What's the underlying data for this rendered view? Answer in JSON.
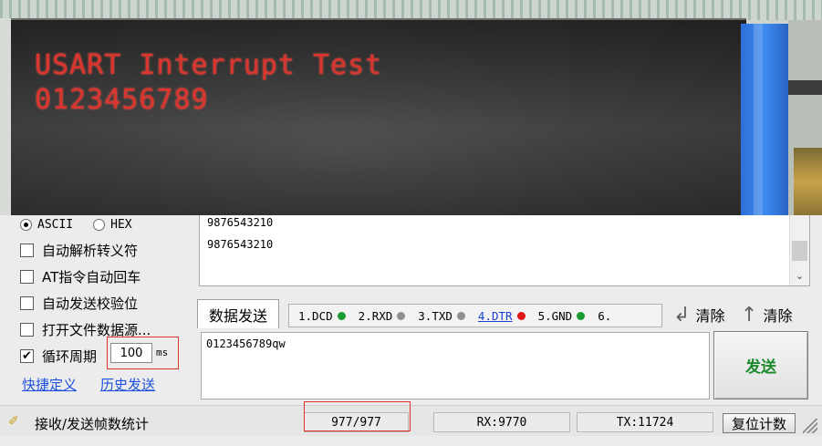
{
  "lcd": {
    "line1": "USART Interrupt Test",
    "line2": "0123456789"
  },
  "options": {
    "format_ascii": "ASCII",
    "format_hex": "HEX",
    "format_selected": "ASCII",
    "auto_escape": "自动解析转义符",
    "at_auto_newline": "AT指令自动回车",
    "auto_checksum": "自动发送校验位",
    "open_file_source": "打开文件数据源...",
    "cycle_period": "循环周期",
    "cycle_checked": true,
    "cycle_value": "100",
    "cycle_unit": "ms",
    "quick_define": "快捷定义",
    "history_send": "历史发送"
  },
  "receive": {
    "lines": [
      "9876543210",
      "9876543210"
    ]
  },
  "send": {
    "tab_label": "数据发送",
    "signals": [
      {
        "label": "1.DCD",
        "dot": "green"
      },
      {
        "label": "2.RXD",
        "dot": "gray"
      },
      {
        "label": "3.TXD",
        "dot": "gray"
      },
      {
        "label": "4.DTR",
        "dot": "red"
      },
      {
        "label": "5.GND",
        "dot": "green"
      },
      {
        "label": "6.",
        "dot": ""
      }
    ],
    "clear_label_1": "清除",
    "clear_label_2": "清除",
    "text": "0123456789qw",
    "send_button": "发送"
  },
  "status": {
    "label": "接收/发送帧数统计",
    "frames": "977/977",
    "rx": "RX:9770",
    "tx": "TX:11724",
    "reset_button": "复位计数"
  },
  "colors": {
    "lcd_text": "#d9342e",
    "highlight": "#e2312b",
    "link": "#1d4fe0",
    "send_button_text": "#1a8a2a"
  }
}
